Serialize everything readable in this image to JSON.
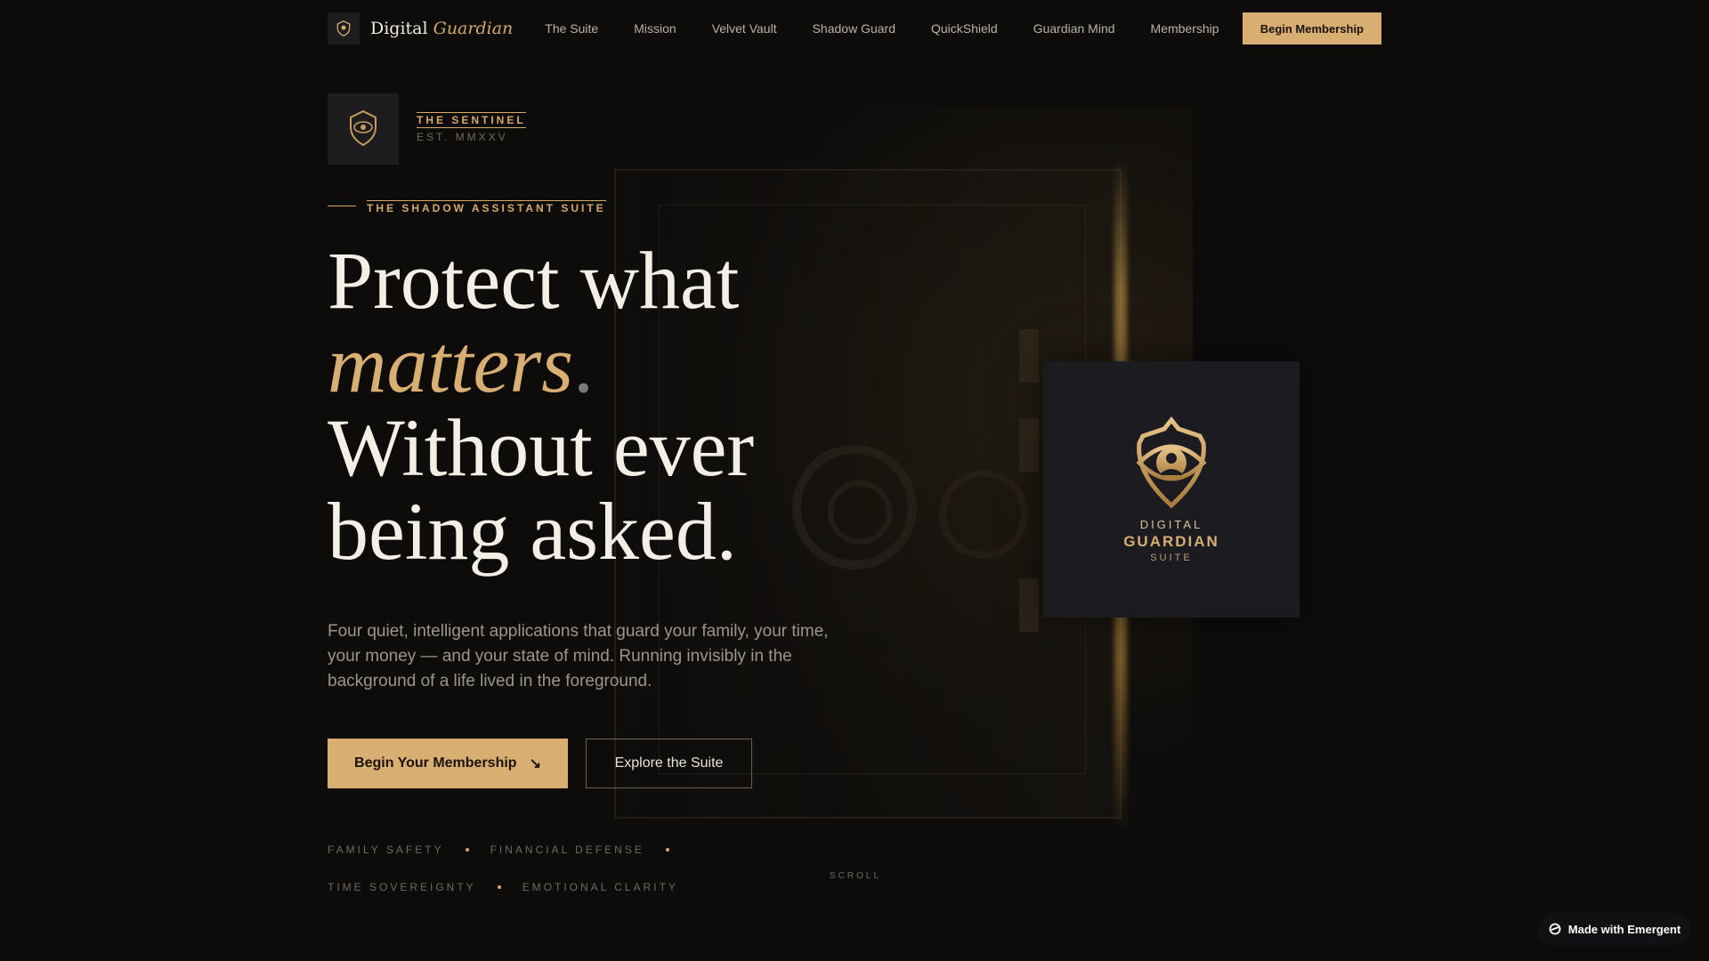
{
  "nav": {
    "brand_first": "Digital",
    "brand_accent": "Guardian",
    "links": [
      "The Suite",
      "Mission",
      "Velvet Vault",
      "Shadow Guard",
      "QuickShield",
      "Guardian Mind",
      "Membership"
    ],
    "cta_label": "Begin Membership"
  },
  "sentinel": {
    "title": "THE SENTINEL",
    "subtitle": "EST. MMXXV"
  },
  "hero": {
    "eyebrow": "THE SHADOW ASSISTANT SUITE",
    "headline_line1": "Protect what",
    "headline_accent": "matters",
    "headline_dot": ".",
    "headline_line3": "Without ever",
    "headline_line4": "being asked.",
    "lede": "Four quiet, intelligent applications that guard your family, your time, your money — and your state of mind. Running invisibly in the background of a life lived in the foreground.",
    "primary_cta": "Begin Your Membership",
    "primary_cta_icon": "↘",
    "secondary_cta": "Explore the Suite",
    "pillars": [
      "FAMILY SAFETY",
      "FINANCIAL DEFENSE",
      "TIME SOVEREIGNTY",
      "EMOTIONAL CLARITY"
    ],
    "scroll_label": "SCROLL"
  },
  "logo_card": {
    "line1": "DIGITAL",
    "line2": "GUARDIAN",
    "line3": "SUITE"
  },
  "badge": {
    "label": "Made with Emergent"
  },
  "colors": {
    "accent": "#d9ae72",
    "background": "#0d0c0b",
    "card": "#1c1b1f"
  },
  "icons": [
    "shield-eye-icon",
    "arrow-down-right-icon",
    "emergent-logo-icon"
  ]
}
